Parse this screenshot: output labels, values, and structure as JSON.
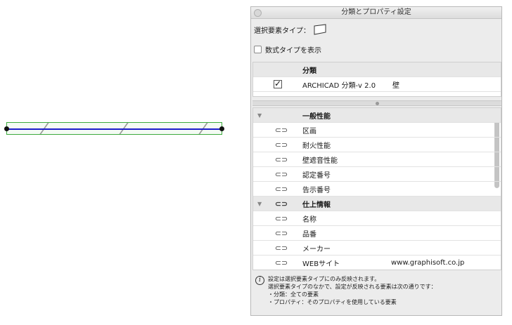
{
  "window": {
    "title": "分類とプロパティ設定"
  },
  "selection": {
    "label": "選択要素タイプ：",
    "type_icon": "wall-shape-icon"
  },
  "formula": {
    "label": "数式タイプを表示",
    "checked": false
  },
  "classification": {
    "header": "分類",
    "rows": [
      {
        "checked": true,
        "system": "ARCHICAD 分類-v 2.0",
        "value": "壁"
      }
    ]
  },
  "properties": {
    "groups": [
      {
        "name": "一般性能",
        "items": [
          {
            "name": "区画",
            "value": ""
          },
          {
            "name": "耐火性能",
            "value": ""
          },
          {
            "name": "壁遮音性能",
            "value": ""
          },
          {
            "name": "認定番号",
            "value": ""
          },
          {
            "name": "告示番号",
            "value": ""
          }
        ]
      },
      {
        "name": "仕上情報",
        "items": [
          {
            "name": "名称",
            "value": ""
          },
          {
            "name": "品番",
            "value": ""
          },
          {
            "name": "メーカー",
            "value": ""
          },
          {
            "name": "WEBサイト",
            "value": "www.graphisoft.co.jp"
          }
        ]
      }
    ]
  },
  "info": {
    "lines": [
      "設定は選択要素タイプにのみ反映されます。",
      "選択要素タイプのなかで、設定が反映される要素は次の通りです：",
      "・分類：全ての要素",
      "・プロパティ：そのプロパティを使用している要素"
    ]
  },
  "colors": {
    "wall_outline": "#3caa3c",
    "reference_line": "#1c1ccc",
    "panel_bg": "#ececec"
  }
}
